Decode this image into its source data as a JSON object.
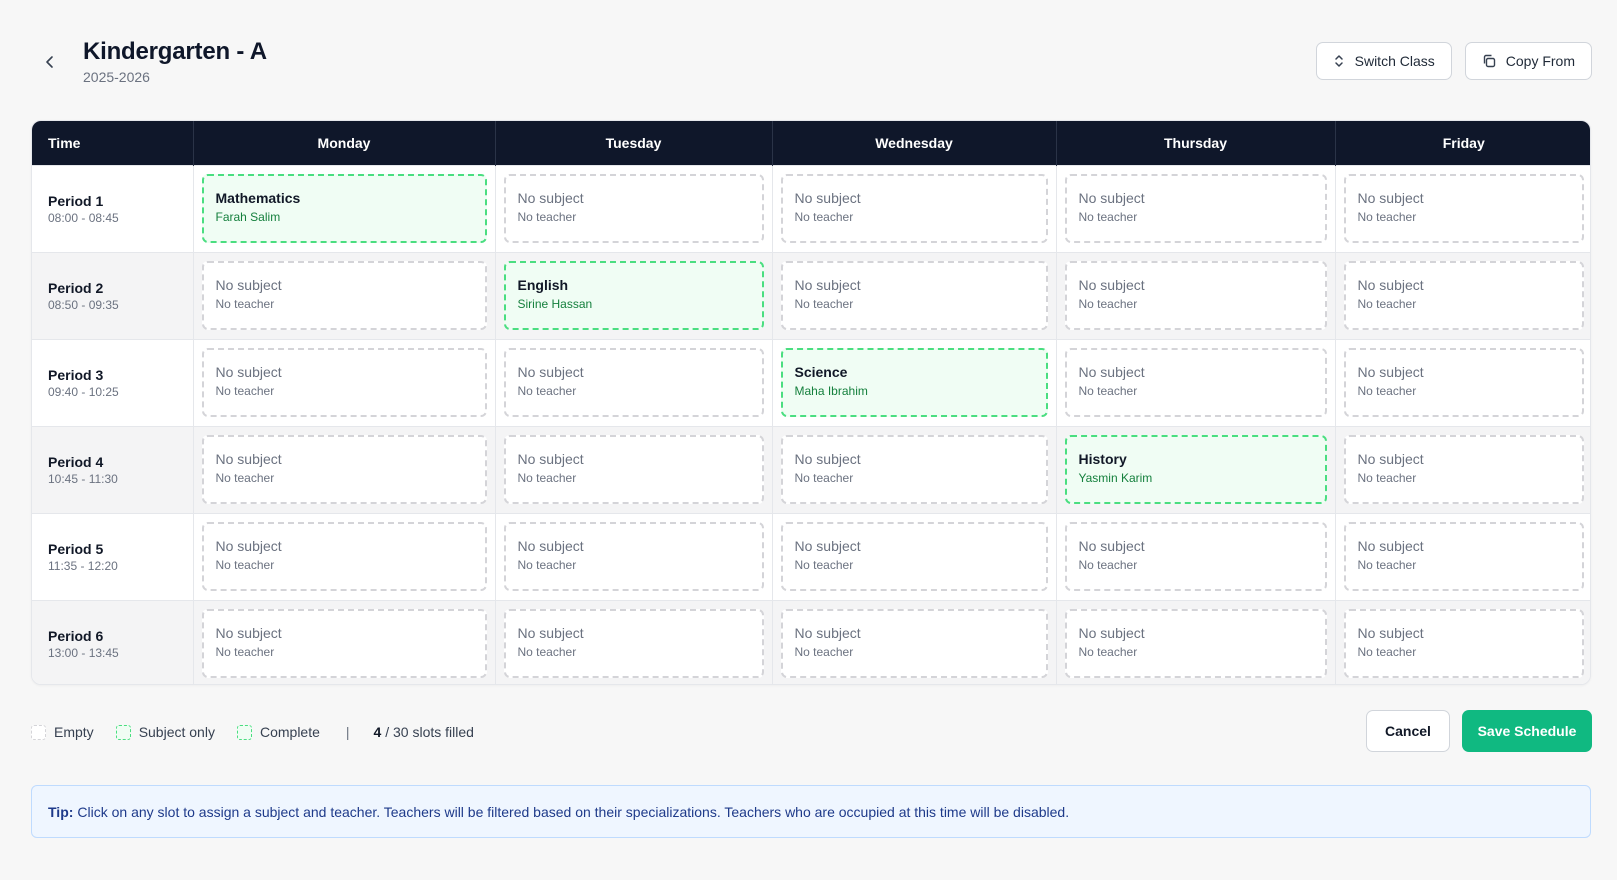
{
  "header": {
    "title": "Kindergarten - A",
    "subtitle": "2025-2026",
    "switch_label": "Switch Class",
    "copy_label": "Copy From"
  },
  "grid": {
    "time_header": "Time",
    "days": [
      "Monday",
      "Tuesday",
      "Wednesday",
      "Thursday",
      "Friday"
    ],
    "empty_subject": "No subject",
    "empty_teacher": "No teacher",
    "periods": [
      {
        "name": "Period 1",
        "time": "08:00 - 08:45",
        "slots": [
          {
            "subject": "Mathematics",
            "teacher": "Farah Salim",
            "filled": true
          },
          {
            "subject": "No subject",
            "teacher": "No teacher",
            "filled": false
          },
          {
            "subject": "No subject",
            "teacher": "No teacher",
            "filled": false
          },
          {
            "subject": "No subject",
            "teacher": "No teacher",
            "filled": false
          },
          {
            "subject": "No subject",
            "teacher": "No teacher",
            "filled": false
          }
        ]
      },
      {
        "name": "Period 2",
        "time": "08:50 - 09:35",
        "slots": [
          {
            "subject": "No subject",
            "teacher": "No teacher",
            "filled": false
          },
          {
            "subject": "English",
            "teacher": "Sirine Hassan",
            "filled": true
          },
          {
            "subject": "No subject",
            "teacher": "No teacher",
            "filled": false
          },
          {
            "subject": "No subject",
            "teacher": "No teacher",
            "filled": false
          },
          {
            "subject": "No subject",
            "teacher": "No teacher",
            "filled": false
          }
        ]
      },
      {
        "name": "Period 3",
        "time": "09:40 - 10:25",
        "slots": [
          {
            "subject": "No subject",
            "teacher": "No teacher",
            "filled": false
          },
          {
            "subject": "No subject",
            "teacher": "No teacher",
            "filled": false
          },
          {
            "subject": "Science",
            "teacher": "Maha Ibrahim",
            "filled": true
          },
          {
            "subject": "No subject",
            "teacher": "No teacher",
            "filled": false
          },
          {
            "subject": "No subject",
            "teacher": "No teacher",
            "filled": false
          }
        ]
      },
      {
        "name": "Period 4",
        "time": "10:45 - 11:30",
        "slots": [
          {
            "subject": "No subject",
            "teacher": "No teacher",
            "filled": false
          },
          {
            "subject": "No subject",
            "teacher": "No teacher",
            "filled": false
          },
          {
            "subject": "No subject",
            "teacher": "No teacher",
            "filled": false
          },
          {
            "subject": "History",
            "teacher": "Yasmin Karim",
            "filled": true
          },
          {
            "subject": "No subject",
            "teacher": "No teacher",
            "filled": false
          }
        ]
      },
      {
        "name": "Period 5",
        "time": "11:35 - 12:20",
        "slots": [
          {
            "subject": "No subject",
            "teacher": "No teacher",
            "filled": false
          },
          {
            "subject": "No subject",
            "teacher": "No teacher",
            "filled": false
          },
          {
            "subject": "No subject",
            "teacher": "No teacher",
            "filled": false
          },
          {
            "subject": "No subject",
            "teacher": "No teacher",
            "filled": false
          },
          {
            "subject": "No subject",
            "teacher": "No teacher",
            "filled": false
          }
        ]
      },
      {
        "name": "Period 6",
        "time": "13:00 - 13:45",
        "slots": [
          {
            "subject": "No subject",
            "teacher": "No teacher",
            "filled": false
          },
          {
            "subject": "No subject",
            "teacher": "No teacher",
            "filled": false
          },
          {
            "subject": "No subject",
            "teacher": "No teacher",
            "filled": false
          },
          {
            "subject": "No subject",
            "teacher": "No teacher",
            "filled": false
          },
          {
            "subject": "No subject",
            "teacher": "No teacher",
            "filled": false
          }
        ]
      }
    ]
  },
  "legend": {
    "empty": "Empty",
    "subject_only": "Subject only",
    "complete": "Complete",
    "separator": "|",
    "filled_count": "4",
    "filled_suffix": " / 30 slots filled"
  },
  "footer": {
    "cancel_label": "Cancel",
    "save_label": "Save Schedule"
  },
  "tip": {
    "label": "Tip:",
    "text": "Click on any slot to assign a subject and teacher. Teachers will be filtered based on their specializations. Teachers who are occupied at this time will be disabled."
  },
  "colors": {
    "header_bg": "#0f172a",
    "filled_border": "#4ade80",
    "filled_bg": "#f0fdf4",
    "teacher_green": "#15803d",
    "save_button": "#10b981",
    "tip_bg": "#eff6ff"
  }
}
